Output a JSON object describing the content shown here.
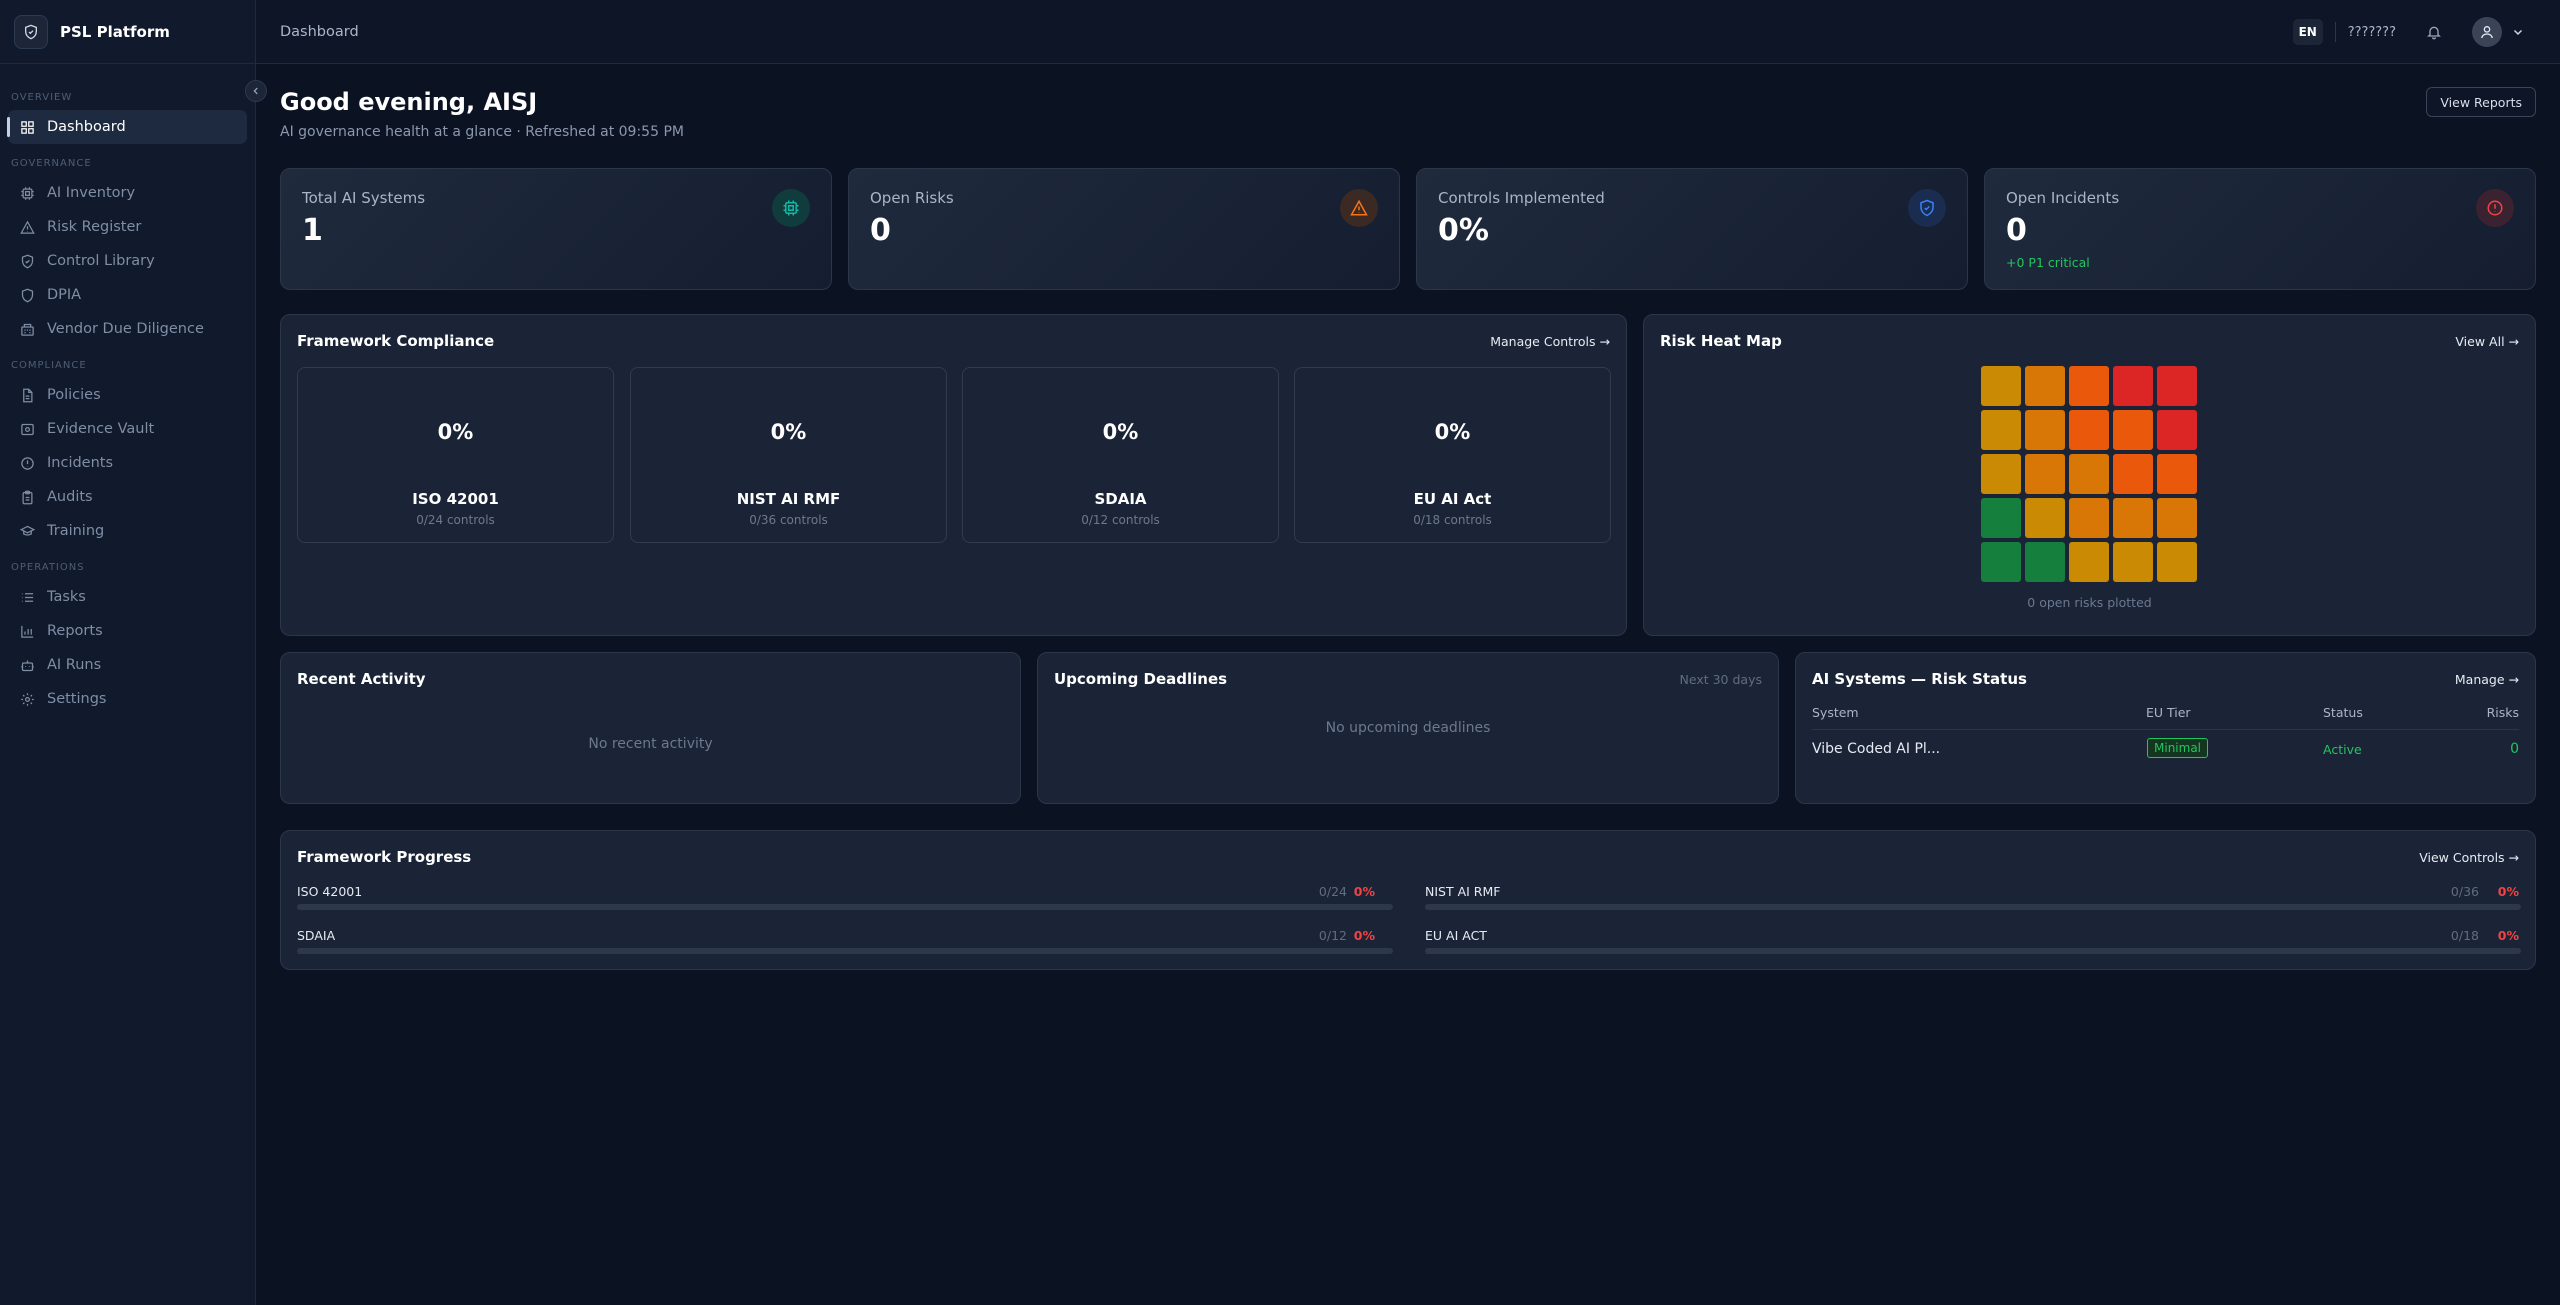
{
  "brand": {
    "name": "PSL Platform"
  },
  "sidebar": {
    "groups": [
      {
        "title": "Overview",
        "items": [
          {
            "label": "Dashboard",
            "icon": "grid-icon"
          }
        ]
      },
      {
        "title": "Governance",
        "items": [
          {
            "label": "AI Inventory",
            "icon": "chip-icon"
          },
          {
            "label": "Risk Register",
            "icon": "warning-icon"
          },
          {
            "label": "Control Library",
            "icon": "shield-check-icon"
          },
          {
            "label": "DPIA",
            "icon": "shield-icon"
          },
          {
            "label": "Vendor Due Diligence",
            "icon": "building-icon"
          }
        ]
      },
      {
        "title": "Compliance",
        "items": [
          {
            "label": "Policies",
            "icon": "document-icon"
          },
          {
            "label": "Evidence Vault",
            "icon": "vault-icon"
          },
          {
            "label": "Incidents",
            "icon": "alert-circle-icon"
          },
          {
            "label": "Audits",
            "icon": "clipboard-icon"
          },
          {
            "label": "Training",
            "icon": "graduation-cap-icon"
          }
        ]
      },
      {
        "title": "Operations",
        "items": [
          {
            "label": "Tasks",
            "icon": "list-icon"
          },
          {
            "label": "Reports",
            "icon": "bar-chart-icon"
          },
          {
            "label": "AI Runs",
            "icon": "robot-icon"
          },
          {
            "label": "Settings",
            "icon": "gear-icon"
          }
        ]
      }
    ]
  },
  "topbar": {
    "breadcrumb": "Dashboard",
    "lang": "EN",
    "user": "???????"
  },
  "header": {
    "greeting": "Good evening, AISJ",
    "subtitle": "AI governance health at a glance · Refreshed at 09:55 PM",
    "view_reports": "View Reports"
  },
  "stats": [
    {
      "label": "Total AI Systems",
      "value": "1",
      "icon": "chip-icon",
      "color": "#14b8a6"
    },
    {
      "label": "Open Risks",
      "value": "0",
      "icon": "warning-icon",
      "color": "#f97316"
    },
    {
      "label": "Controls Implemented",
      "value": "0%",
      "icon": "shield-check-icon",
      "color": "#3b82f6"
    },
    {
      "label": "Open Incidents",
      "value": "0",
      "note": "+0 P1 critical",
      "icon": "alert-circle-icon",
      "color": "#ef4444"
    }
  ],
  "framework_compliance": {
    "title": "Framework Compliance",
    "link": "Manage Controls →",
    "items": [
      {
        "pct": "0%",
        "name": "ISO 42001",
        "controls": "0/24 controls"
      },
      {
        "pct": "0%",
        "name": "NIST AI RMF",
        "controls": "0/36 controls"
      },
      {
        "pct": "0%",
        "name": "SDAIA",
        "controls": "0/12 controls"
      },
      {
        "pct": "0%",
        "name": "EU AI Act",
        "controls": "0/18 controls"
      }
    ]
  },
  "heat_map": {
    "title": "Risk Heat Map",
    "link": "View All →",
    "caption": "0 open risks plotted",
    "rows": [
      [
        "#ca8a04",
        "#d97706",
        "#ea580c",
        "#dc2626",
        "#dc2626"
      ],
      [
        "#ca8a04",
        "#d97706",
        "#ea580c",
        "#ea580c",
        "#dc2626"
      ],
      [
        "#ca8a04",
        "#d97706",
        "#d97706",
        "#ea580c",
        "#ea580c"
      ],
      [
        "#15803d",
        "#ca8a04",
        "#d97706",
        "#d97706",
        "#d97706"
      ],
      [
        "#15803d",
        "#15803d",
        "#ca8a04",
        "#ca8a04",
        "#ca8a04"
      ]
    ]
  },
  "recent_activity": {
    "title": "Recent Activity",
    "empty": "No recent activity"
  },
  "deadlines": {
    "title": "Upcoming Deadlines",
    "hint": "Next 30 days",
    "empty": "No upcoming deadlines"
  },
  "risk_status": {
    "title": "AI Systems — Risk Status",
    "link": "Manage →",
    "headers": [
      "System",
      "EU Tier",
      "Status",
      "Risks"
    ],
    "rows": [
      {
        "system": "Vibe Coded AI Pl...",
        "tier": "Minimal",
        "status": "Active",
        "risks": "0"
      }
    ]
  },
  "framework_progress": {
    "title": "Framework Progress",
    "link": "View Controls →",
    "items": [
      {
        "name": "ISO 42001",
        "count": "0/24",
        "pct": "0%",
        "fraction": 0
      },
      {
        "name": "NIST AI RMF",
        "count": "0/36",
        "pct": "0%",
        "fraction": 0
      },
      {
        "name": "SDAIA",
        "count": "0/12",
        "pct": "0%",
        "fraction": 0
      },
      {
        "name": "EU AI ACT",
        "count": "0/18",
        "pct": "0%",
        "fraction": 0
      }
    ]
  }
}
